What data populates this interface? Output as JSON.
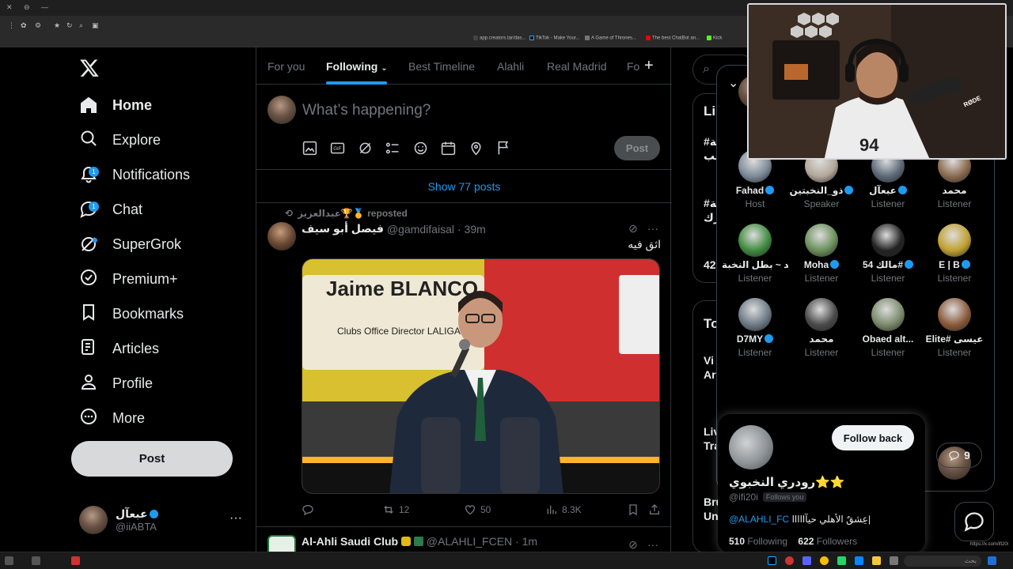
{
  "browser": {
    "bookmarks": [
      {
        "label": "app.creators.tar/das...",
        "color": "#444"
      },
      {
        "label": "TikTok - Make Your...",
        "color": "#000"
      },
      {
        "label": "A Game of Thrones...",
        "color": "#777"
      },
      {
        "label": "The best ChatBot an...",
        "color": "#e00"
      },
      {
        "label": "Kick",
        "color": "#53fc18"
      }
    ],
    "status_url": "https://x.com/ifi20i"
  },
  "nav": {
    "items": [
      {
        "label": "Home",
        "icon": "home-icon",
        "active": true
      },
      {
        "label": "Explore",
        "icon": "search-icon"
      },
      {
        "label": "Notifications",
        "icon": "bell-icon",
        "badge": "1"
      },
      {
        "label": "Chat",
        "icon": "chat-icon",
        "badge": "1"
      },
      {
        "label": "SuperGrok",
        "icon": "grok-icon",
        "dot": true
      },
      {
        "label": "Premium+",
        "icon": "premium-icon"
      },
      {
        "label": "Bookmarks",
        "icon": "bookmark-icon"
      },
      {
        "label": "Articles",
        "icon": "article-icon"
      },
      {
        "label": "Profile",
        "icon": "profile-icon"
      },
      {
        "label": "More",
        "icon": "more-icon"
      }
    ],
    "post_button": "Post",
    "account": {
      "name": "عبعآل",
      "handle": "@iiABTA",
      "more": "···"
    }
  },
  "tabs": {
    "items": [
      "For you",
      "Following",
      "Best Timeline",
      "Alahli",
      "Real Madrid",
      "Fo"
    ],
    "selected": "Following",
    "plus": "+"
  },
  "compose": {
    "placeholder": "What’s happening?",
    "post_label": "Post"
  },
  "feed": {
    "show_posts": "Show 77 posts",
    "tweet": {
      "repost_by": "عبدالعزيز🏆🥇 reposted",
      "author_name": "فيصل أبو سيف",
      "author_handle": "@gamdifaisal",
      "time": "· 39m",
      "text": "اثق فيه",
      "media_caption_name": "Jaime BLANCO",
      "media_caption_role": "Clubs Office Director LALIGA",
      "retweets": "12",
      "likes": "50",
      "views": "8.3K"
    },
    "tweet2": {
      "author_name": "Al-Ahli Saudi Club",
      "author_handle": "@ALAHLI_FCEN",
      "time": "· 1m"
    }
  },
  "right": {
    "snippets": [
      "Li",
      "#قة",
      "لب",
      "#قة",
      "رك",
      "42",
      "To",
      "Vi",
      "Ar",
      "Liv",
      "Tra",
      "Bru",
      "Un"
    ]
  },
  "spaces": {
    "people": [
      {
        "name": "Fahad",
        "role": "Host",
        "verified": true
      },
      {
        "name": "ذو_النخبتين",
        "role": "Speaker",
        "verified": true
      },
      {
        "name": "عبعآل",
        "role": "Listener",
        "verified": true
      },
      {
        "name": "محمد",
        "role": "Listener",
        "verified": false
      },
      {
        "name": "مهند ~ بطل النخبة",
        "role": "Listener",
        "verified": false
      },
      {
        "name": "Moha",
        "role": "Listener",
        "verified": true
      },
      {
        "name": "مالك 54#",
        "role": "Listener",
        "verified": true
      },
      {
        "name": "E | B",
        "role": "Listener",
        "verified": true
      },
      {
        "name": "D7MY",
        "role": "Listener",
        "verified": true
      },
      {
        "name": "محمد",
        "role": "Listener",
        "verified": false
      },
      {
        "name": "Obaed alt...",
        "role": "Listener",
        "verified": false
      },
      {
        "name": "Elite# عيسى",
        "role": "Listener",
        "verified": false
      }
    ],
    "reply_count": "9"
  },
  "hover_card": {
    "name": "رودري النخبوي⭐⭐",
    "handle": "@ifi20i",
    "follows_you": "Follows you",
    "follow_back": "Follow back",
    "bio_link": "@ALAHLI_FC",
    "bio_text": "عِشقٌ الأهلي حيآااااا|",
    "following_count": "510",
    "following_label": "Following",
    "followers_count": "622",
    "followers_label": "Followers"
  },
  "webcam": {
    "mic_brand": "RØDE"
  },
  "taskbar": {
    "search_placeholder": "بحث"
  },
  "colors": {
    "accent": "#1d9bf0",
    "bg": "#000000",
    "border": "#2f3336",
    "muted": "#71767b"
  }
}
